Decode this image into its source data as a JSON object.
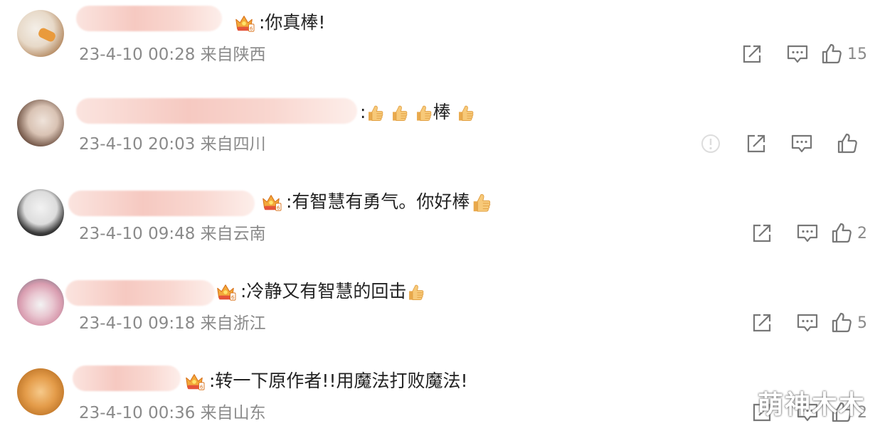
{
  "comments": [
    {
      "text": ":你真棒!",
      "meta": "23-4-10 00:28 来自陕西",
      "likes": "15"
    },
    {
      "text": ":",
      "text_suffix": "棒",
      "meta": "23-4-10 20:03 来自四川",
      "likes": ""
    },
    {
      "text": ":有智慧有勇气。你好棒",
      "meta": "23-4-10 09:48 来自云南",
      "likes": "2"
    },
    {
      "text": ":冷静又有智慧的回击",
      "meta": "23-4-10 09:18 来自浙江",
      "likes": "5"
    },
    {
      "text": ":转一下原作者!!用魔法打败魔法!",
      "meta": "23-4-10 00:36 来自山东",
      "likes": "2"
    }
  ],
  "watermark": "萌神木木",
  "colors": {
    "meta_gray": "#8a8a8a",
    "blur_pink": "#f6c9c1",
    "thumb_yellow": "#f5c26b"
  },
  "icons": [
    "share-icon",
    "comment-icon",
    "like-icon",
    "report-icon",
    "thumbs-up-emoji",
    "vip-crown-icon"
  ]
}
